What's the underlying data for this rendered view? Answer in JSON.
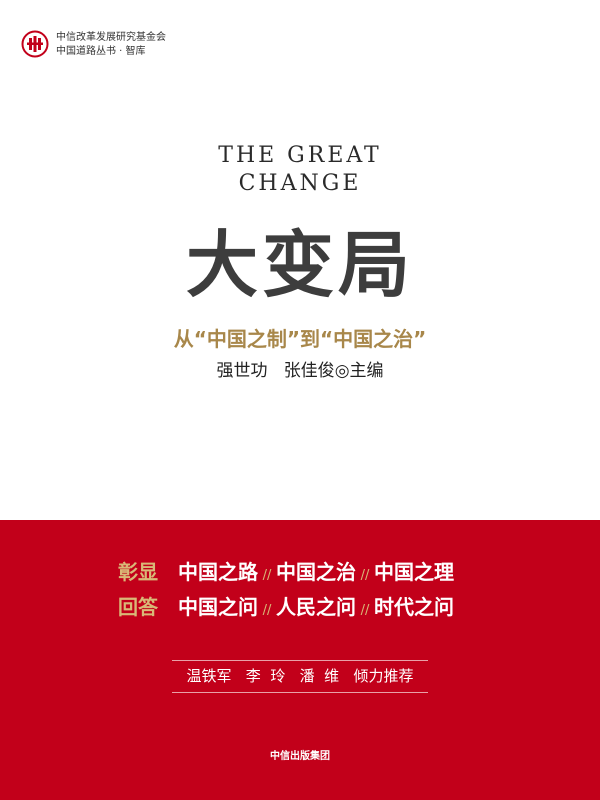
{
  "header": {
    "logo_icon": "citic-logo-icon",
    "series_line1": "中信改革发展研究基金会",
    "series_line2": "中国道路丛书 · 智库"
  },
  "title": {
    "en_line1": "THE GREAT",
    "en_line2": "CHANGE",
    "zh": "大变局",
    "subtitle": "从“中国之制”到“中国之治”"
  },
  "authors": {
    "name1": "强世功",
    "name2": "张佳俊",
    "role": "◎主编"
  },
  "band": {
    "row1_label": "彰显",
    "row1_items": [
      "中国之路",
      "中国之治",
      "中国之理"
    ],
    "row2_label": "回答",
    "row2_items": [
      "中国之问",
      "人民之问",
      "时代之问"
    ],
    "separator": "//",
    "recommenders": "温铁军   李  玲   潘  维   倾力推荐",
    "publisher": "中信出版集团"
  },
  "colors": {
    "band_red": "#c2001a",
    "gold": "#a8874a",
    "title_gray": "#3d3d3d"
  }
}
